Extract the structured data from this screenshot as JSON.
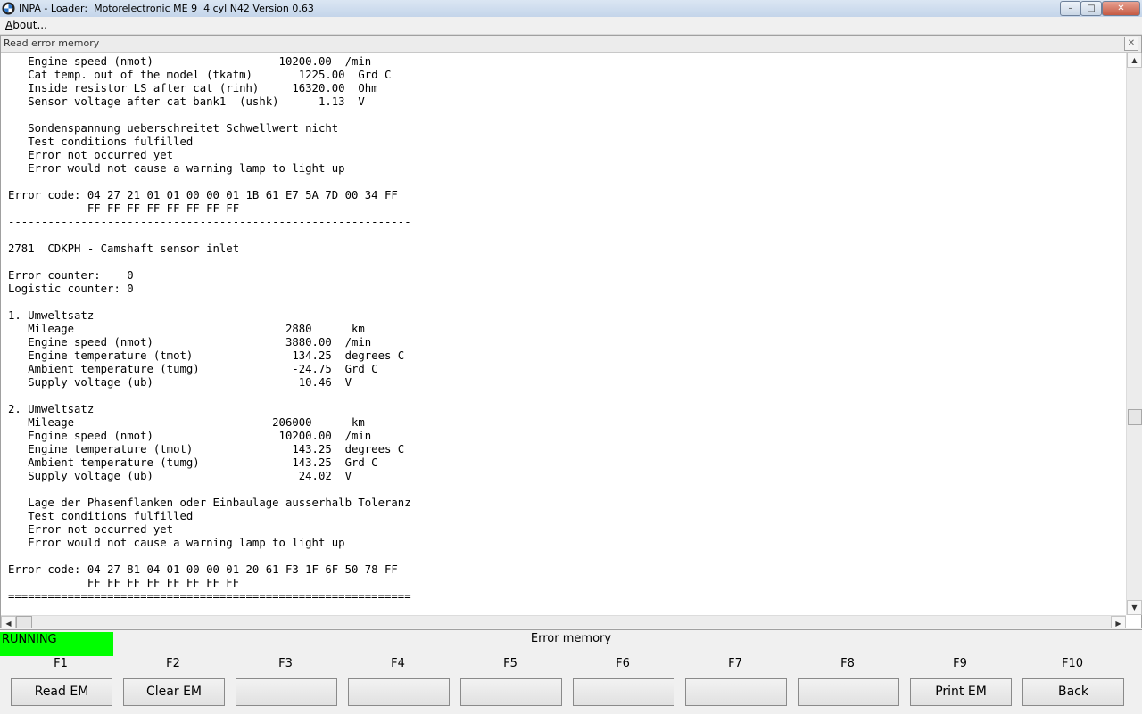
{
  "window": {
    "title": "INPA - Loader:  Motorelectronic ME 9  4 cyl N42 Version 0.63",
    "minimize_glyph": "–",
    "maximize_glyph": "□",
    "close_glyph": "✕"
  },
  "menu": {
    "items": [
      {
        "label": "About..."
      }
    ]
  },
  "child_window": {
    "title": "Read error memory",
    "close_glyph": "✕"
  },
  "error_text": "   Engine speed (nmot)                   10200.00  /min\n   Cat temp. out of the model (tkatm)       1225.00  Grd C\n   Inside resistor LS after cat (rinh)     16320.00  Ohm\n   Sensor voltage after cat bank1  (ushk)      1.13  V\n\n   Sondenspannung ueberschreitet Schwellwert nicht\n   Test conditions fulfilled\n   Error not occurred yet\n   Error would not cause a warning lamp to light up\n\nError code: 04 27 21 01 01 00 00 01 1B 61 E7 5A 7D 00 34 FF\n            FF FF FF FF FF FF FF FF\n-------------------------------------------------------------\n\n2781  CDKPH - Camshaft sensor inlet\n\nError counter:    0\nLogistic counter: 0\n\n1. Umweltsatz\n   Mileage                                2880      km\n   Engine speed (nmot)                    3880.00  /min\n   Engine temperature (tmot)               134.25  degrees C\n   Ambient temperature (tumg)              -24.75  Grd C\n   Supply voltage (ub)                      10.46  V\n\n2. Umweltsatz\n   Mileage                              206000      km\n   Engine speed (nmot)                   10200.00  /min\n   Engine temperature (tmot)               143.25  degrees C\n   Ambient temperature (tumg)              143.25  Grd C\n   Supply voltage (ub)                      24.02  V\n\n   Lage der Phasenflanken oder Einbaulage ausserhalb Toleranz\n   Test conditions fulfilled\n   Error not occurred yet\n   Error would not cause a warning lamp to light up\n\nError code: 04 27 81 04 01 00 00 01 20 61 F3 1F 6F 50 78 FF\n            FF FF FF FF FF FF FF FF\n=============================================================",
  "status": {
    "text": "RUNNING",
    "color": "#00ff00"
  },
  "screen_title": "Error memory",
  "function_keys": [
    {
      "key": "F1",
      "label": "Read EM"
    },
    {
      "key": "F2",
      "label": "Clear EM"
    },
    {
      "key": "F3",
      "label": ""
    },
    {
      "key": "F4",
      "label": ""
    },
    {
      "key": "F5",
      "label": ""
    },
    {
      "key": "F6",
      "label": ""
    },
    {
      "key": "F7",
      "label": ""
    },
    {
      "key": "F8",
      "label": ""
    },
    {
      "key": "F9",
      "label": "Print EM"
    },
    {
      "key": "F10",
      "label": "Back"
    }
  ],
  "scroll_glyphs": {
    "up": "▲",
    "down": "▼",
    "left": "◀",
    "right": "▶"
  }
}
